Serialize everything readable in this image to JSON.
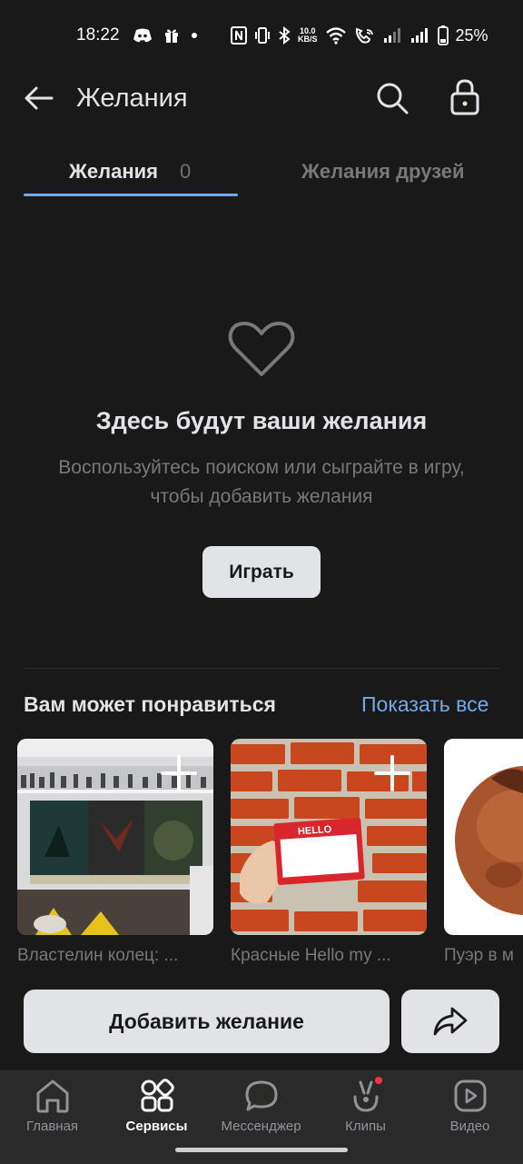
{
  "status_bar": {
    "time": "18:22",
    "net_speed_value": "10.0",
    "net_speed_unit": "KB/S",
    "battery": "25%",
    "icons": [
      "discord-icon",
      "gift-icon",
      "dot-icon",
      "nfc-icon",
      "vibrate-icon",
      "bluetooth-icon",
      "wifi-icon",
      "wifi-call-icon",
      "signal-icon",
      "signal-icon",
      "battery-icon"
    ]
  },
  "header": {
    "title": "Желания",
    "icons": [
      "back-arrow-icon",
      "search-icon",
      "lock-icon"
    ]
  },
  "tabs": [
    {
      "label": "Желания",
      "count": "0",
      "active": true
    },
    {
      "label": "Желания друзей",
      "active": false
    }
  ],
  "empty_state": {
    "icon": "heart-outline-icon",
    "title": "Здесь будут ваши желания",
    "subtitle": "Воспользуйтесь поиском или сыграйте в игру, чтобы добавить желания",
    "button": "Играть"
  },
  "recommendations": {
    "title": "Вам может понравиться",
    "show_all": "Показать все",
    "items": [
      {
        "caption": "Властелин колец: ...",
        "image": "lotr-posters-photo"
      },
      {
        "caption": "Красные Hello my ...",
        "image": "hello-sticker-photo",
        "badge_text": "HELLO"
      },
      {
        "caption": "Пуэр в м",
        "image": "puer-tea-photo"
      }
    ]
  },
  "actions": {
    "add_wish": "Добавить желание",
    "share_icon": "share-icon"
  },
  "tabbar": {
    "items": [
      {
        "label": "Главная",
        "icon": "home-icon",
        "active": false
      },
      {
        "label": "Сервисы",
        "icon": "services-icon",
        "active": true
      },
      {
        "label": "Мессенджер",
        "icon": "messenger-icon",
        "active": false
      },
      {
        "label": "Клипы",
        "icon": "clips-icon",
        "active": false,
        "notification": true
      },
      {
        "label": "Видео",
        "icon": "video-icon",
        "active": false
      }
    ]
  },
  "colors": {
    "background": "#19191a",
    "accent": "#71aaeb",
    "button_bg": "#e1e3e6",
    "text_secondary": "#76787a"
  }
}
